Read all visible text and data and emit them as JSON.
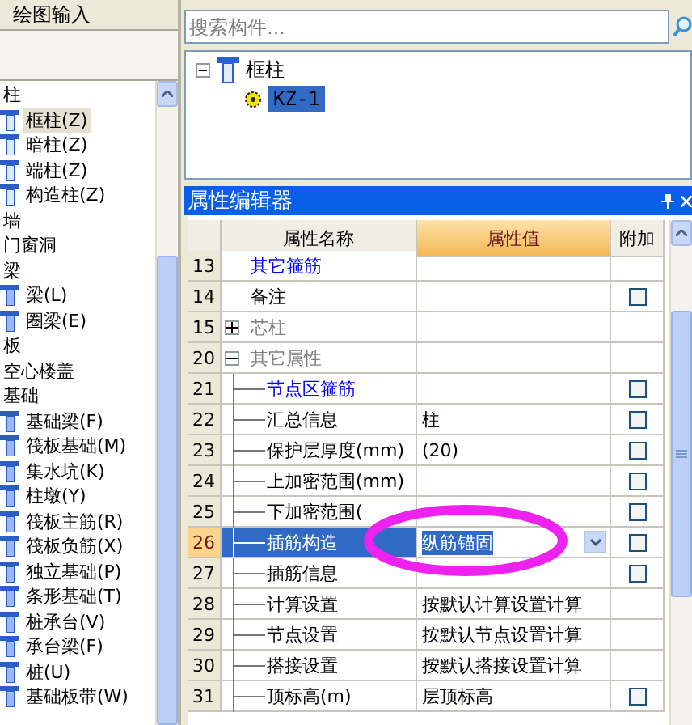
{
  "left_panel": {
    "title": "绘图输入",
    "component_tree": [
      {
        "label": "柱",
        "children": [
          {
            "label": "框柱(Z)",
            "selected": true
          },
          {
            "label": "暗柱(Z)",
            "selected": false
          },
          {
            "label": "端柱(Z)",
            "selected": false
          },
          {
            "label": "构造柱(Z)",
            "selected": false
          }
        ]
      },
      {
        "label": "墙"
      },
      {
        "label": "门窗洞"
      },
      {
        "label": "梁",
        "children": [
          {
            "label": "梁(L)",
            "selected": false
          },
          {
            "label": "圈梁(E)",
            "selected": false
          }
        ]
      },
      {
        "label": "板"
      },
      {
        "label": "空心楼盖"
      },
      {
        "label": "基础",
        "children": [
          {
            "label": "基础梁(F)",
            "selected": false
          },
          {
            "label": "筏板基础(M)",
            "selected": false
          },
          {
            "label": "集水坑(K)",
            "selected": false
          },
          {
            "label": "柱墩(Y)",
            "selected": false
          },
          {
            "label": "筏板主筋(R)",
            "selected": false
          },
          {
            "label": "筏板负筋(X)",
            "selected": false
          },
          {
            "label": "独立基础(P)",
            "selected": false
          },
          {
            "label": "条形基础(T)",
            "selected": false
          },
          {
            "label": "桩承台(V)",
            "selected": false
          },
          {
            "label": "承台梁(F)",
            "selected": false
          },
          {
            "label": "桩(U)",
            "selected": false
          },
          {
            "label": "基础板带(W)",
            "selected": false
          }
        ]
      }
    ]
  },
  "search": {
    "placeholder": "搜索构件..."
  },
  "element_tree": [
    {
      "label": "框柱",
      "expanded": true,
      "children": [
        {
          "label": "KZ-1",
          "selected": true
        }
      ]
    }
  ],
  "property_editor": {
    "title": "属性编辑器",
    "columns": [
      "属性名称",
      "属性值",
      "附加"
    ],
    "rows": [
      {
        "no": "13",
        "name": "其它箍筋",
        "kind": "heading",
        "selected": false
      },
      {
        "no": "14",
        "name": "备注",
        "kind": "field",
        "selected": false,
        "checkbox": {
          "checked": false
        }
      },
      {
        "no": "15",
        "name": "芯柱",
        "kind": "group",
        "expanded": false,
        "selected": false
      },
      {
        "no": "20",
        "name": "其它属性",
        "kind": "group",
        "expanded": true,
        "selected": false,
        "children": [
          {
            "no": "21",
            "name": "节点区箍筋",
            "kind": "heading",
            "selected": false,
            "checkbox": {
              "checked": false
            }
          },
          {
            "no": "22",
            "name": "汇总信息",
            "value": "柱",
            "kind": "field",
            "selected": false,
            "checkbox": {
              "checked": false
            }
          },
          {
            "no": "23",
            "name": "保护层厚度(mm)",
            "value": "(20)",
            "kind": "field",
            "selected": false,
            "checkbox": {
              "checked": false
            }
          },
          {
            "no": "24",
            "name": "上加密范围(mm)",
            "kind": "field",
            "selected": false,
            "checkbox": {
              "checked": false
            }
          },
          {
            "no": "25",
            "name": "下加密范围(",
            "kind": "field",
            "selected": false,
            "checkbox": {
              "checked": false
            }
          },
          {
            "no": "26",
            "name": "插筋构造",
            "value": "纵筋锚固",
            "kind": "dropdown",
            "selected": true,
            "checkbox": {
              "checked": false
            }
          },
          {
            "no": "27",
            "name": "插筋信息",
            "kind": "field",
            "selected": false,
            "checkbox": {
              "checked": false
            }
          },
          {
            "no": "28",
            "name": "计算设置",
            "value": "按默认计算设置计算",
            "kind": "field",
            "selected": false
          },
          {
            "no": "29",
            "name": "节点设置",
            "value": "按默认节点设置计算",
            "kind": "field",
            "selected": false
          },
          {
            "no": "30",
            "name": "搭接设置",
            "value": "按默认搭接设置计算",
            "kind": "field",
            "selected": false
          },
          {
            "no": "31",
            "name": "顶标高(m)",
            "value": "层顶标高",
            "kind": "field",
            "selected": false,
            "checkbox": {
              "checked": false
            }
          }
        ]
      }
    ]
  }
}
